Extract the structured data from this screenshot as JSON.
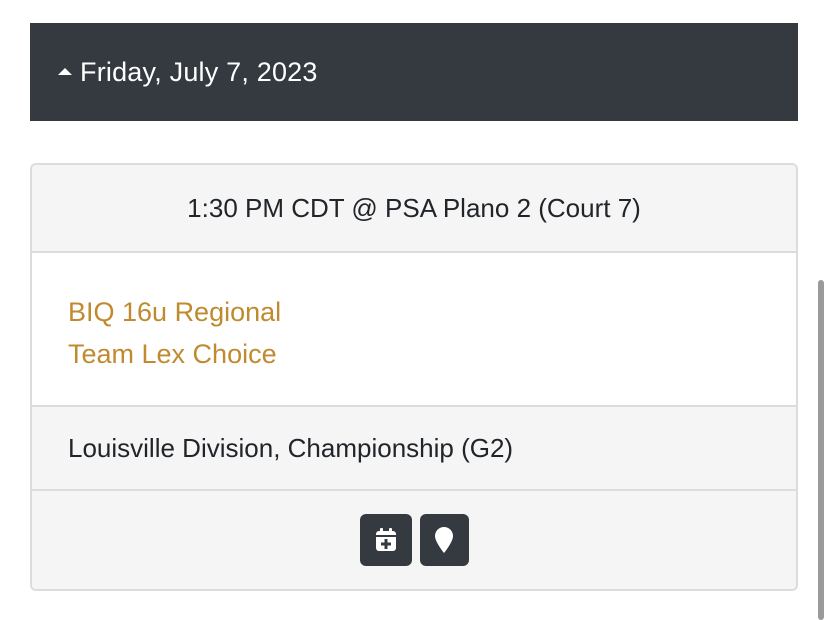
{
  "date_header": {
    "title": "Friday, July 7, 2023",
    "caret_icon": "caret-up-icon"
  },
  "match": {
    "time_location": "1:30 PM CDT @ PSA Plano 2 (Court 7)",
    "teams": [
      "BIQ 16u Regional",
      "Team Lex Choice"
    ],
    "division": "Louisville Division, Championship (G2)",
    "actions": [
      {
        "icon": "calendar-plus-icon"
      },
      {
        "icon": "map-marker-icon"
      }
    ]
  },
  "colors": {
    "header_bg": "#343a40",
    "team_link": "#c08a2f",
    "panel_bg": "#f5f5f5",
    "border": "#dcdcdc"
  }
}
